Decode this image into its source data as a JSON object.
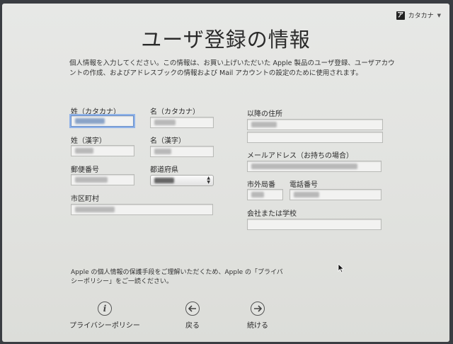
{
  "ime": {
    "label": "カタカナ",
    "icon_glyph": "ア"
  },
  "title": "ユーザ登録の情報",
  "intro": "個人情報を入力してください。この情報は、お買い上げいただいた Apple 製品のユーザ登録、ユーザアカウントの作成、およびアドレスブックの情報および Mail アカウントの設定のために使用されます。",
  "labels": {
    "last_kana": "姓（カタカナ）",
    "first_kana": "名（カタカナ）",
    "last_kanji": "姓（漢字）",
    "first_kanji": "名（漢字）",
    "postal": "郵便番号",
    "prefecture": "都道府県",
    "city": "市区町村",
    "address": "以降の住所",
    "email": "メールアドレス（お持ちの場合）",
    "area_code": "市外局番",
    "phone": "電話番号",
    "company": "会社または学校"
  },
  "notice": "Apple の個人情報の保護手段をご理解いただくため、Apple の「プライバシーポリシー」をご一読ください。",
  "buttons": {
    "privacy": "プライバシーポリシー",
    "back": "戻る",
    "continue": "続ける"
  },
  "icons": {
    "privacy": "info-icon",
    "back": "arrow-left-icon",
    "continue": "arrow-right-icon"
  }
}
